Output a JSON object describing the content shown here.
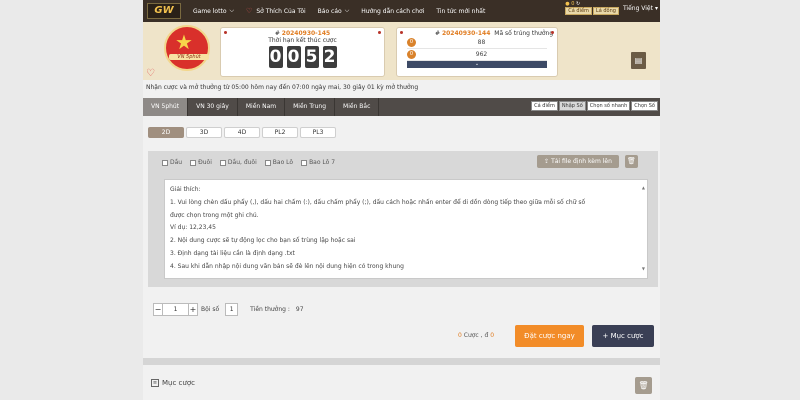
{
  "brand": {
    "logo_text": "GW"
  },
  "nav": {
    "items": [
      {
        "label": "Game lotto",
        "chevron": true
      },
      {
        "label": "Sở Thích Của Tôi",
        "heart": true
      },
      {
        "label": "Báo cáo",
        "chevron": true
      },
      {
        "label": "Hướng dẫn cách chơi"
      },
      {
        "label": "Tin tức mới nhất"
      }
    ],
    "coin_count": "0",
    "mini_buttons": [
      "Cá điểm",
      "Lá đồng"
    ],
    "language": "Tiếng Việt"
  },
  "game": {
    "logo_name": "VN 5phút"
  },
  "current_round": {
    "round_id": "20240930-145",
    "deadline_label": "Thời hạn kết thúc cược",
    "countdown": [
      "0",
      "0",
      "5",
      "2"
    ]
  },
  "last_round": {
    "round_id": "20240930-144",
    "result_label": "Mã số trúng thưởng",
    "results": [
      {
        "ball": "0",
        "value": "88"
      },
      {
        "ball": "0",
        "value": "962"
      }
    ]
  },
  "notice": "Nhận cược và mở thưởng từ 05:00 hôm nay đến 07:00 ngày mai,    30 giây 01 kỳ mở thưởng",
  "tabs": [
    "VN 5phút",
    "VN 30 giây",
    "Miền Nam",
    "Miền Trung",
    "Miền Bắc"
  ],
  "sub_tabs": [
    "Cá điểm",
    "Nhập Số",
    "Chọn số nhanh",
    "Chọn Số"
  ],
  "bet_types": [
    "2D",
    "3D",
    "4D",
    "PL2",
    "PL3"
  ],
  "options": [
    "Dầu",
    "Đuôi",
    "Dầu, đuôi",
    "Bao Lô",
    "Bao Lô 7"
  ],
  "upload_label": "Tải file định kèm lên",
  "instructions": [
    "Giải thích:",
    "1. Vui lòng chèn dấu phẩy (,), dấu hai chấm (:), dấu chấm phẩy (;), dấu cách hoặc nhấn enter để di dồn dòng tiếp theo giữa mỗi số chữ số",
    "được chọn trong một ghi chú.",
    "Ví dụ: 12,23,45",
    "2. Nội dung cược sẽ tự động lọc cho bạn số trùng lặp hoặc sai",
    "3. Định dạng tài liệu cần là định dạng .txt",
    "4. Sau khi dẫn nhập nội dung văn bản sẽ đè lên nội dung hiện có trong khung"
  ],
  "stepper": {
    "minus": "−",
    "value": "1",
    "plus": "+"
  },
  "multiplier": {
    "label": "Bội số",
    "value": "1"
  },
  "prize": {
    "label": "Tiền thưởng :",
    "value": "97"
  },
  "bet_summary": {
    "count": "0",
    "count_label": "Cược ,",
    "currency": "đ",
    "amount": "0"
  },
  "buttons": {
    "bet_now": "Đặt cược ngay",
    "bet_list": "Mục cược"
  },
  "footer": {
    "title": "Mục cược"
  }
}
